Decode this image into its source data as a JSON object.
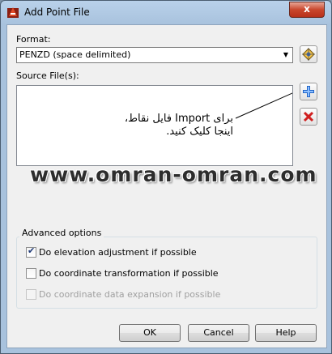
{
  "window": {
    "title": "Add Point File",
    "close_glyph": "x"
  },
  "format": {
    "label": "Format:",
    "selected": "PENZD (space delimited)"
  },
  "source": {
    "label": "Source File(s):",
    "note_line1": "برای Import فایل نقاط،",
    "note_line2": "اینجا کلیک کنید."
  },
  "watermark": "www.omran-omran.com",
  "advanced": {
    "title": "Advanced options",
    "options": [
      {
        "label": "Do elevation adjustment if possible",
        "checked": true,
        "enabled": true
      },
      {
        "label": "Do coordinate transformation if possible",
        "checked": false,
        "enabled": true
      },
      {
        "label": "Do coordinate data expansion if possible",
        "checked": false,
        "enabled": false
      }
    ]
  },
  "buttons": {
    "ok": "OK",
    "cancel": "Cancel",
    "help": "Help"
  },
  "icons": {
    "app": "civil3d-app-icon",
    "format_manager": "point-file-format-icon",
    "add": "add-files-icon",
    "remove": "remove-file-icon"
  },
  "colors": {
    "add_icon": "#1f64c8",
    "remove_icon": "#d02020",
    "close_button": "#c9462c"
  }
}
